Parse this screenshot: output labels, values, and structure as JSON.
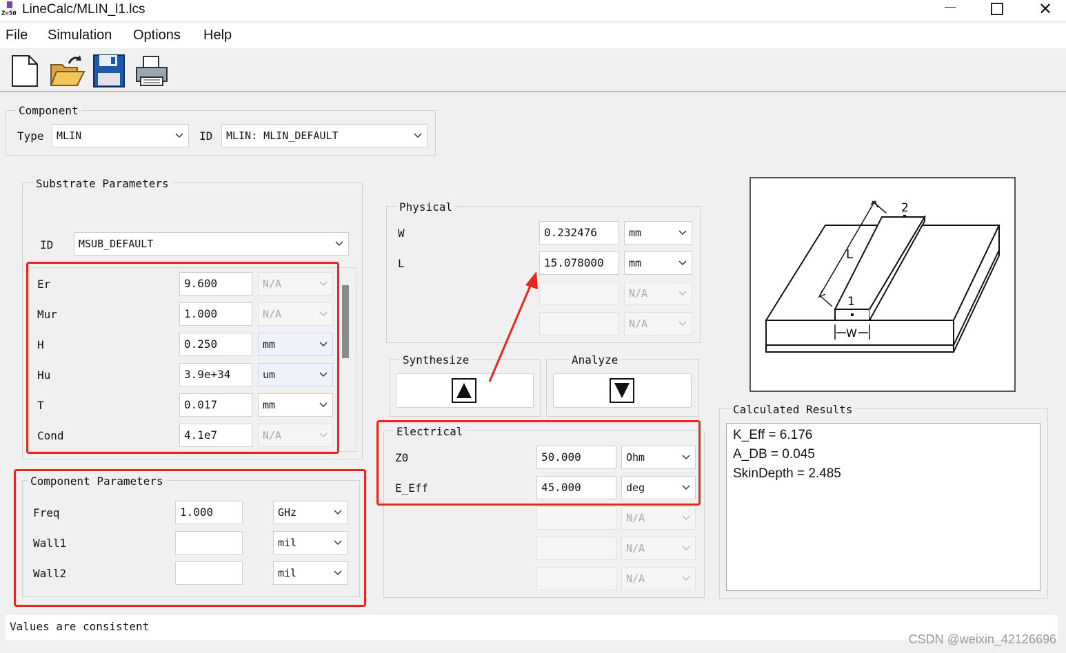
{
  "window": {
    "title": "LineCalc/MLIN_l1.lcs",
    "icon_label": "Z=50",
    "minimize_icon": "minimize-icon",
    "maximize_icon": "maximize-icon",
    "close_icon": "close-icon"
  },
  "menu": [
    "File",
    "Simulation",
    "Options",
    "Help"
  ],
  "toolbar": [
    "new-file-icon",
    "open-folder-icon",
    "save-disk-icon",
    "print-icon"
  ],
  "component": {
    "title": "Component",
    "type_label": "Type",
    "type_value": "MLIN",
    "id_label": "ID",
    "id_value": "MLIN: MLIN_DEFAULT"
  },
  "substrate": {
    "title": "Substrate Parameters",
    "id_label": "ID",
    "id_value": "MSUB_DEFAULT",
    "rows": [
      {
        "label": "Er",
        "value": "9.600",
        "unit": "N/A",
        "unit_disabled": true
      },
      {
        "label": "Mur",
        "value": "1.000",
        "unit": "N/A",
        "unit_disabled": true
      },
      {
        "label": "H",
        "value": "0.250",
        "unit": "mm",
        "unit_disabled": false
      },
      {
        "label": "Hu",
        "value": "3.9e+34",
        "unit": "um",
        "unit_disabled": false
      },
      {
        "label": "T",
        "value": "0.017",
        "unit": "mm",
        "unit_disabled": false
      },
      {
        "label": "Cond",
        "value": "4.1e7",
        "unit": "N/A",
        "unit_disabled": true
      }
    ]
  },
  "component_params": {
    "title": "Component Parameters",
    "rows": [
      {
        "label": "Freq",
        "value": "1.000",
        "unit": "GHz"
      },
      {
        "label": "Wall1",
        "value": "",
        "unit": "mil"
      },
      {
        "label": "Wall2",
        "value": "",
        "unit": "mil"
      }
    ]
  },
  "physical": {
    "title": "Physical",
    "rows": [
      {
        "label": "W",
        "value": "0.232476",
        "unit": "mm",
        "disabled": false
      },
      {
        "label": "L",
        "value": "15.078000",
        "unit": "mm",
        "disabled": false
      },
      {
        "label": "",
        "value": "",
        "unit": "N/A",
        "disabled": true
      },
      {
        "label": "",
        "value": "",
        "unit": "N/A",
        "disabled": true
      }
    ]
  },
  "synthesize": {
    "title": "Synthesize",
    "icon": "arrow-up-icon"
  },
  "analyze": {
    "title": "Analyze",
    "icon": "arrow-down-icon"
  },
  "electrical": {
    "title": "Electrical",
    "rows": [
      {
        "label": "Z0",
        "value": "50.000",
        "unit": "Ohm",
        "disabled": false
      },
      {
        "label": "E_Eff",
        "value": "45.000",
        "unit": "deg",
        "disabled": false
      },
      {
        "label": "",
        "value": "",
        "unit": "N/A",
        "disabled": true
      },
      {
        "label": "",
        "value": "",
        "unit": "N/A",
        "disabled": true
      },
      {
        "label": "",
        "value": "",
        "unit": "N/A",
        "disabled": true
      }
    ]
  },
  "diagram": {
    "label_length": "L",
    "label_width": "W",
    "port1": "1",
    "port2": "2"
  },
  "results": {
    "title": "Calculated Results",
    "lines": [
      "K_Eff = 6.176",
      "A_DB = 0.045",
      "SkinDepth = 2.485"
    ]
  },
  "status": "Values are consistent",
  "watermark": "CSDN @weixin_42126696",
  "colors": {
    "highlight": "#e8261f",
    "window_bg": "#f0f0f0"
  }
}
